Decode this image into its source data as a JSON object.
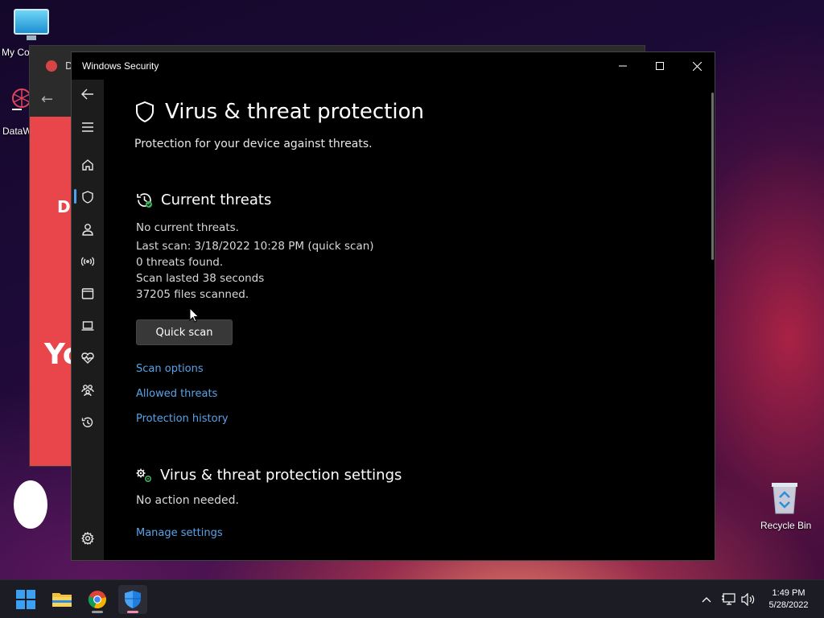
{
  "desktop": {
    "icons": [
      {
        "label": "My Co"
      },
      {
        "label": "DataW"
      },
      {
        "label": "Recycle Bin"
      }
    ]
  },
  "background_window": {
    "tab_text": "D",
    "content_initial": "D",
    "content_heading": "Yo"
  },
  "window": {
    "title": "Windows Security",
    "controls": [
      "minimize-icon",
      "maximize-icon",
      "close-icon"
    ]
  },
  "sidebar": {
    "items": [
      {
        "icon": "back-arrow-icon"
      },
      {
        "icon": "hamburger-menu-icon"
      },
      {
        "icon": "home-icon"
      },
      {
        "icon": "shield-icon",
        "selected": true
      },
      {
        "icon": "person-icon"
      },
      {
        "icon": "network-icon"
      },
      {
        "icon": "app-browser-icon"
      },
      {
        "icon": "laptop-icon"
      },
      {
        "icon": "heart-pulse-icon"
      },
      {
        "icon": "family-icon"
      },
      {
        "icon": "history-icon"
      },
      {
        "icon": "gear-icon"
      }
    ],
    "accent_color": "#4ca2f0"
  },
  "page": {
    "title": "Virus & threat protection",
    "subtitle": "Protection for your device against threats."
  },
  "current_threats": {
    "heading": "Current threats",
    "status": "No current threats.",
    "last_scan": "Last scan: 3/18/2022 10:28 PM (quick scan)",
    "threats_found": "0 threats found.",
    "scan_duration": "Scan lasted 38 seconds",
    "files_scanned": "37205 files scanned.",
    "quick_scan_button": "Quick scan",
    "links": {
      "scan_options": "Scan options",
      "allowed_threats": "Allowed threats",
      "protection_history": "Protection history"
    }
  },
  "settings_section": {
    "heading": "Virus & threat protection settings",
    "status": "No action needed.",
    "manage_link": "Manage settings"
  },
  "link_color": "#5ba3e8",
  "taskbar": {
    "apps": [
      "windows-start-icon",
      "file-explorer-icon",
      "chrome-icon",
      "windows-security-icon"
    ],
    "tray": [
      "chevron-up-icon",
      "network-icon",
      "volume-icon"
    ],
    "time": "1:49 PM",
    "date": "5/28/2022"
  }
}
